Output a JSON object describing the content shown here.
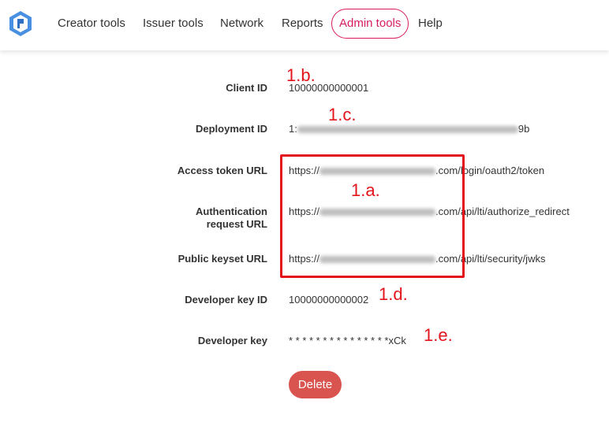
{
  "nav": {
    "items": [
      {
        "label": "Creator tools"
      },
      {
        "label": "Issuer tools"
      },
      {
        "label": "Network"
      },
      {
        "label": "Reports"
      },
      {
        "label": "Admin tools"
      },
      {
        "label": "Help"
      }
    ],
    "active_color": "#d81b60"
  },
  "fields": {
    "client_id": {
      "label": "Client ID",
      "value": "10000000000001"
    },
    "deployment_id": {
      "label": "Deployment ID",
      "prefix": "1:",
      "suffix": "9b"
    },
    "access_token_url": {
      "label": "Access token URL",
      "prefix": "https://",
      "suffix": ".com/login/oauth2/token"
    },
    "auth_request_url": {
      "label_line1": "Authentication",
      "label_line2": "request URL",
      "prefix": "https://",
      "suffix": ".com/api/lti/authorize_redirect"
    },
    "public_keyset_url": {
      "label": "Public keyset URL",
      "prefix": "https://",
      "suffix": ".com/api/lti/security/jwks"
    },
    "developer_key_id": {
      "label": "Developer key ID",
      "value": "10000000000002"
    },
    "developer_key": {
      "label": "Developer key",
      "value": "* * * * * * * * * * * * * * *xCk"
    }
  },
  "annotations": {
    "a": "1.a.",
    "b": "1.b.",
    "c": "1.c.",
    "d": "1.d.",
    "e": "1.e."
  },
  "actions": {
    "delete_label": "Delete"
  },
  "colors": {
    "annotation": "#e3141b",
    "delete_button": "#d9534f"
  }
}
